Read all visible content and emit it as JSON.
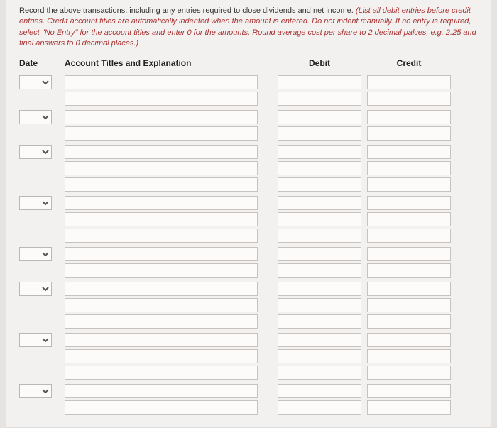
{
  "instructions": {
    "black": "Record the above transactions, including any entries required to close dividends and net income. ",
    "red": "(List all debit entries before credit entries. Credit account titles are automatically indented when the amount is entered. Do not indent manually. If no entry is required, select \"No Entry\" for the account titles and enter 0 for the amounts. Round average cost per share to 2 decimal palces, e.g. 2.25 and final answers to 0 decimal places.)"
  },
  "headers": {
    "date": "Date",
    "account": "Account Titles and Explanation",
    "debit": "Debit",
    "credit": "Credit"
  },
  "groups": [
    {
      "rows": 2
    },
    {
      "rows": 2
    },
    {
      "rows": 3
    },
    {
      "rows": 3
    },
    {
      "rows": 2
    },
    {
      "rows": 3
    },
    {
      "rows": 3
    },
    {
      "rows": 2
    }
  ],
  "placeholders": {
    "select_empty": "",
    "input_empty": ""
  }
}
